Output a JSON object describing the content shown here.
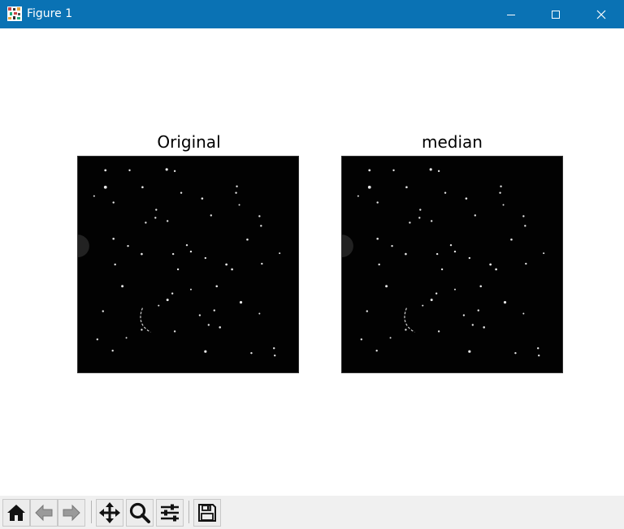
{
  "window": {
    "title": "Figure 1"
  },
  "subplots": [
    {
      "title": "Original"
    },
    {
      "title": "median"
    }
  ],
  "toolbar": {
    "buttons": [
      "home",
      "back",
      "forward",
      "pan",
      "zoom",
      "configure-subplots",
      "save"
    ]
  }
}
